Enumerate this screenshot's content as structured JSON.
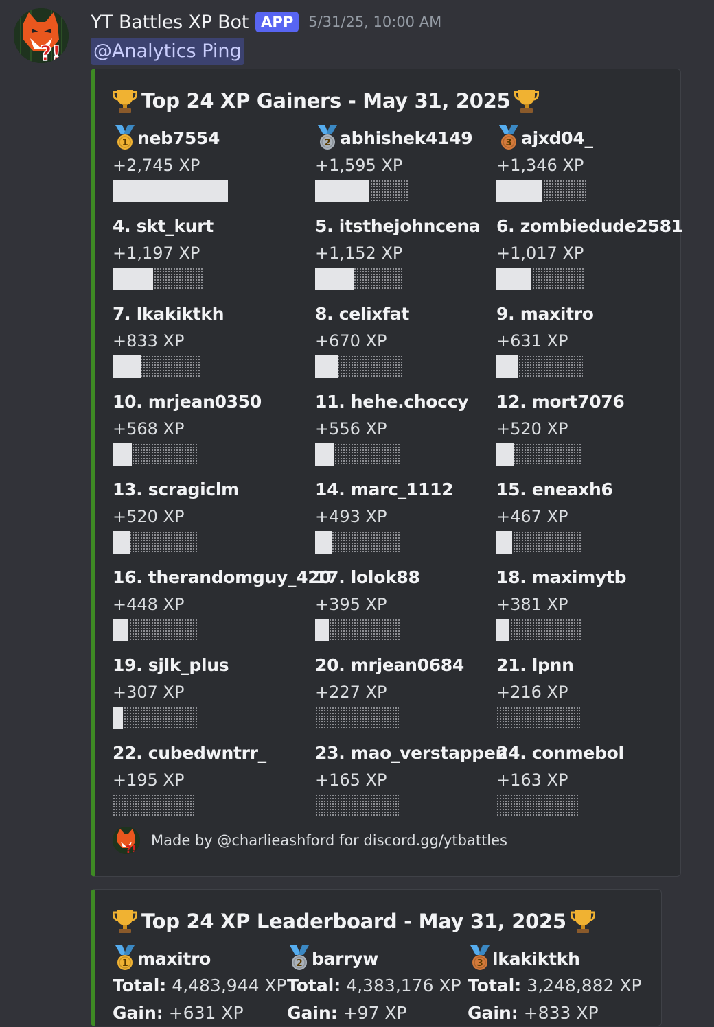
{
  "message": {
    "author": "YT Battles XP Bot",
    "app_tag": "APP",
    "timestamp": "5/31/25, 10:00 AM",
    "mention": "@Analytics Ping"
  },
  "gainers": {
    "title": "Top 24 XP Gainers - May 31, 2025",
    "entries": [
      {
        "name": "neb7554",
        "xp": "+2,745 XP",
        "gain": 2745,
        "medal": "gold-medal-icon"
      },
      {
        "name": "abhishek4149",
        "xp": "+1,595 XP",
        "gain": 1595,
        "medal": "silver-medal-icon"
      },
      {
        "name": "ajxd04_",
        "xp": "+1,346 XP",
        "gain": 1346,
        "medal": "bronze-medal-icon"
      },
      {
        "name": "4. skt_kurt",
        "xp": "+1,197 XP",
        "gain": 1197
      },
      {
        "name": "5. itsthejohncena",
        "xp": "+1,152 XP",
        "gain": 1152
      },
      {
        "name": "6. zombiedude2581",
        "xp": "+1,017 XP",
        "gain": 1017
      },
      {
        "name": "7. lkakiktkh",
        "xp": "+833 XP",
        "gain": 833
      },
      {
        "name": "8. celixfat",
        "xp": "+670 XP",
        "gain": 670
      },
      {
        "name": "9. maxitro",
        "xp": "+631 XP",
        "gain": 631
      },
      {
        "name": "10. mrjean0350",
        "xp": "+568 XP",
        "gain": 568
      },
      {
        "name": "11. hehe.choccy",
        "xp": "+556 XP",
        "gain": 556
      },
      {
        "name": "12. mort7076",
        "xp": "+520 XP",
        "gain": 520
      },
      {
        "name": "13. scragiclm",
        "xp": "+520 XP",
        "gain": 520
      },
      {
        "name": "14. marc_1112",
        "xp": "+493 XP",
        "gain": 493
      },
      {
        "name": "15. eneaxh6",
        "xp": "+467 XP",
        "gain": 467
      },
      {
        "name": "16. therandomguy_420",
        "xp": "+448 XP",
        "gain": 448
      },
      {
        "name": "17. lolok88",
        "xp": "+395 XP",
        "gain": 395
      },
      {
        "name": "18. maximytb",
        "xp": "+381 XP",
        "gain": 381
      },
      {
        "name": "19. sjlk_plus",
        "xp": "+307 XP",
        "gain": 307
      },
      {
        "name": "20. mrjean0684",
        "xp": "+227 XP",
        "gain": 227
      },
      {
        "name": "21. lpnn",
        "xp": "+216 XP",
        "gain": 216
      },
      {
        "name": "22. cubedwntrr_",
        "xp": "+195 XP",
        "gain": 195
      },
      {
        "name": "23. mao_verstappen",
        "xp": "+165 XP",
        "gain": 165
      },
      {
        "name": "24. conmebol",
        "xp": "+163 XP",
        "gain": 163
      }
    ],
    "footer": "Made by @charlieashford for discord.gg/ytbattles"
  },
  "leaderboard": {
    "title": "Top 24 XP Leaderboard - May 31, 2025",
    "total_label": "Total:",
    "gain_label": "Gain:",
    "entries": [
      {
        "name": "maxitro",
        "total": "4,483,944 XP",
        "gain": "+631 XP",
        "medal": "gold-medal-icon"
      },
      {
        "name": "barryw",
        "total": "4,383,176 XP",
        "gain": "+97 XP",
        "medal": "silver-medal-icon"
      },
      {
        "name": "lkakiktkh",
        "total": "3,248,882 XP",
        "gain": "+833 XP",
        "medal": "bronze-medal-icon"
      }
    ]
  },
  "colors": {
    "embed_accent": "#3e8a24",
    "app_tag": "#5865f2",
    "bar_fill": "#e4e5e8",
    "gold": "#f0b232",
    "silver": "#aab2bb",
    "bronze": "#d47a3a",
    "ribbon": "#55acee"
  }
}
